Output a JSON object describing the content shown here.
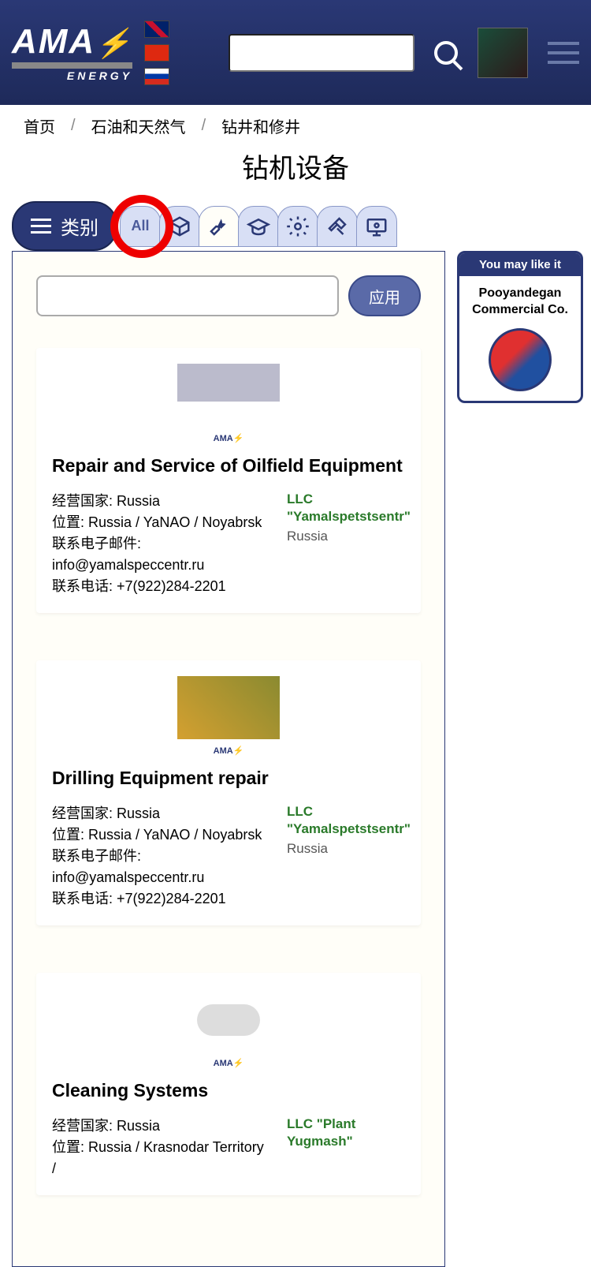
{
  "header": {
    "logo": "AMA",
    "logoSub": "ENERGY"
  },
  "breadcrumb": {
    "home": "首页",
    "cat1": "石油和天然气",
    "cat2": "钻井和修井"
  },
  "pageTitle": "钻机设备",
  "categoryBtn": "类别",
  "tabs": {
    "all": "All"
  },
  "filter": {
    "apply": "应用"
  },
  "sidebar": {
    "title": "You may like it",
    "company": "Pooyandegan Commercial Co."
  },
  "labels": {
    "country": "经营国家: ",
    "location": "位置: ",
    "email": "联系电子邮件: ",
    "phone": "联系电话: "
  },
  "cards": [
    {
      "title": "Repair and Service of Oilfield Equipment",
      "country": "Russia",
      "location": "Russia / YaNAO / Noyabrsk",
      "email": "info@yamalspeccentr.ru",
      "phone": "+7(922)284-2201",
      "company": "LLC \"Yamalspetstsentr\"",
      "ccountry": "Russia"
    },
    {
      "title": "Drilling Equipment repair",
      "country": "Russia",
      "location": "Russia / YaNAO / Noyabrsk",
      "email": "info@yamalspeccentr.ru",
      "phone": "+7(922)284-2201",
      "company": "LLC \"Yamalspetstsentr\"",
      "ccountry": "Russia"
    },
    {
      "title": "Cleaning Systems",
      "country": "Russia",
      "location": "Russia / Krasnodar Territory /",
      "email": "",
      "phone": "",
      "company": "LLC \"Plant Yugmash\"",
      "ccountry": ""
    }
  ]
}
